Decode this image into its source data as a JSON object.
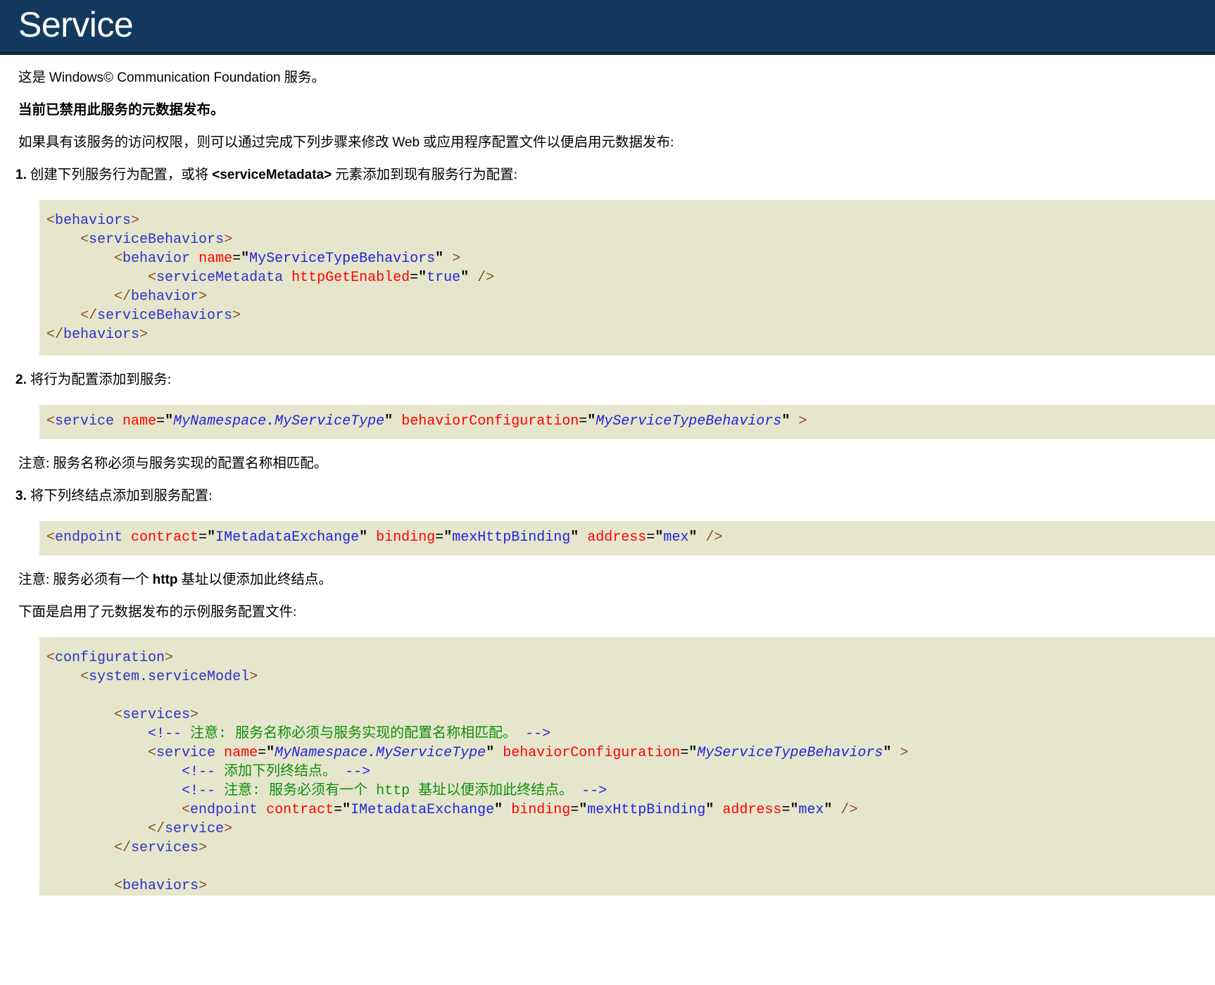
{
  "header": {
    "title": "Service",
    "bg_color": "#14395f",
    "underline_color": "#0b2342",
    "text_color": "#ffffff"
  },
  "intro": {
    "line1_pre": "这是 ",
    "line1_latin": "Windows© Communication Foundation",
    "line1_post": " 服务。",
    "disabled_notice": "当前已禁用此服务的元数据发布。",
    "instructions_pre": "如果具有该服务的访问权限，则可以通过完成下列步骤来修改 ",
    "instructions_latin": "Web",
    "instructions_post": " 或应用程序配置文件以便启用元数据发布:"
  },
  "steps": [
    {
      "number": "1.",
      "text_pre": " 创建下列服务行为配置，或将 ",
      "text_code": "<serviceMetadata>",
      "text_post": " 元素添加到现有服务行为配置:"
    },
    {
      "number": "2.",
      "text_pre": " 将行为配置添加到服务:",
      "text_code": "",
      "text_post": ""
    },
    {
      "number": "3.",
      "text_pre": " 将下列终结点添加到服务配置:",
      "text_code": "",
      "text_post": ""
    }
  ],
  "notes": {
    "note1": "注意: 服务名称必须与服务实现的配置名称相匹配。",
    "note2_pre": "注意: 服务必须有一个 ",
    "note2_latin": "http",
    "note2_post": " 基址以便添加此终结点。",
    "sample_intro": "下面是启用了元数据发布的示例服务配置文件:"
  },
  "code": {
    "block1": {
      "lines": [
        "<behaviors>",
        "    <serviceBehaviors>",
        "        <behavior name=\"MyServiceTypeBehaviors\" >",
        "            <serviceMetadata httpGetEnabled=\"true\" />",
        "        </behavior>",
        "    </serviceBehaviors>",
        "</behaviors>"
      ]
    },
    "block2": {
      "lines": [
        "<service name=\"MyNamespace.MyServiceType\" behaviorConfiguration=\"MyServiceTypeBehaviors\" >"
      ]
    },
    "block3": {
      "lines": [
        "<endpoint contract=\"IMetadataExchange\" binding=\"mexHttpBinding\" address=\"mex\" />"
      ]
    },
    "block4": {
      "lines": [
        "<configuration>",
        "    <system.serviceModel>",
        "",
        "        <services>",
        "            <!-- 注意: 服务名称必须与服务实现的配置名称相匹配。 -->",
        "            <service name=\"MyNamespace.MyServiceType\" behaviorConfiguration=\"MyServiceTypeBehaviors\" >",
        "                <!-- 添加下列终结点。 -->",
        "                <!-- 注意: 服务必须有一个 http 基址以便添加此终结点。 -->",
        "                <endpoint contract=\"IMetadataExchange\" binding=\"mexHttpBinding\" address=\"mex\" />",
        "            </service>",
        "        </services>",
        "",
        "        <behaviors>"
      ]
    }
  },
  "syntax_colors": {
    "bracket": "#8b4a1e",
    "tag": "#3030c8",
    "attribute": "#ff0000",
    "value": "#2222dd",
    "comment": "#0d8f0d",
    "code_background": "#e6e6cc"
  }
}
